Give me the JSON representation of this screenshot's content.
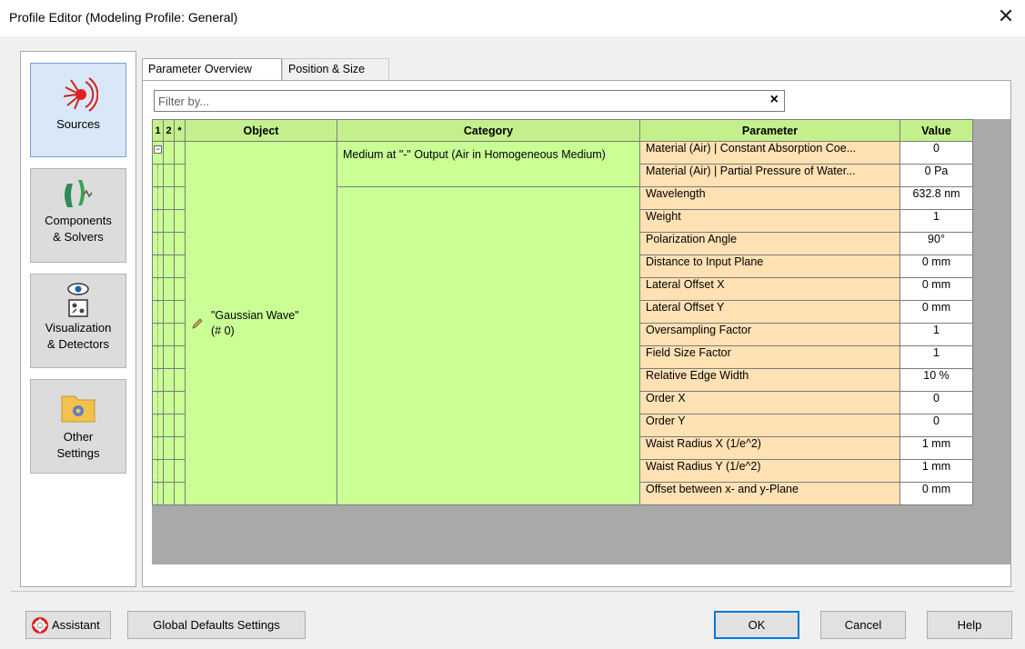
{
  "window": {
    "title": "Profile Editor (Modeling Profile: General)"
  },
  "sidebar": {
    "items": [
      {
        "label": "Sources",
        "icon": "sources-burst-icon"
      },
      {
        "label_line1": "Components",
        "label_line2": "& Solvers",
        "icon": "components-lens-icon"
      },
      {
        "label_line1": "Visualization",
        "label_line2": "& Detectors",
        "icon": "eye-detector-icon"
      },
      {
        "label_line1": "Other",
        "label_line2": "Settings",
        "icon": "folder-gear-icon"
      }
    ]
  },
  "tabs": [
    "Parameter Overview",
    "Position & Size"
  ],
  "filter": {
    "placeholder": "Filter by...",
    "clear": "×"
  },
  "table": {
    "columns": [
      "1",
      "2",
      "*",
      "Object",
      "Category",
      "Parameter",
      "Value"
    ],
    "object": {
      "line1": "\"Gaussian Wave\"",
      "line2": "(# 0)"
    },
    "category_medium": "Medium at \"-\" Output (Air in Homogeneous Medium)",
    "rows": [
      {
        "param": "Material (Air) | Constant Absorption Coe...",
        "value": "0"
      },
      {
        "param": "Material (Air) | Partial Pressure of Water...",
        "value": "0 Pa"
      },
      {
        "param": "Wavelength",
        "value": "632.8 nm"
      },
      {
        "param": "Weight",
        "value": "1"
      },
      {
        "param": "Polarization Angle",
        "value": "90°"
      },
      {
        "param": "Distance to Input Plane",
        "value": "0 mm"
      },
      {
        "param": "Lateral Offset X",
        "value": "0 mm"
      },
      {
        "param": "Lateral Offset Y",
        "value": "0 mm"
      },
      {
        "param": "Oversampling Factor",
        "value": "1"
      },
      {
        "param": "Field Size Factor",
        "value": "1"
      },
      {
        "param": "Relative Edge Width",
        "value": "10 %"
      },
      {
        "param": "Order X",
        "value": "0"
      },
      {
        "param": "Order Y",
        "value": "0"
      },
      {
        "param": "Waist Radius X (1/e^2)",
        "value": "1 mm"
      },
      {
        "param": "Waist Radius Y (1/e^2)",
        "value": "1 mm"
      },
      {
        "param": "Offset between x- and y-Plane",
        "value": "0 mm"
      }
    ]
  },
  "footer": {
    "assistant": "Assistant",
    "global_defaults": "Global Defaults Settings",
    "ok": "OK",
    "cancel": "Cancel",
    "help": "Help"
  },
  "colors": {
    "header_green": "#c3f08c",
    "cell_green": "#caff96",
    "param_orange": "#ffe1b4",
    "grid_gray": "#a9a9a9",
    "accent_blue": "#0078d7"
  }
}
